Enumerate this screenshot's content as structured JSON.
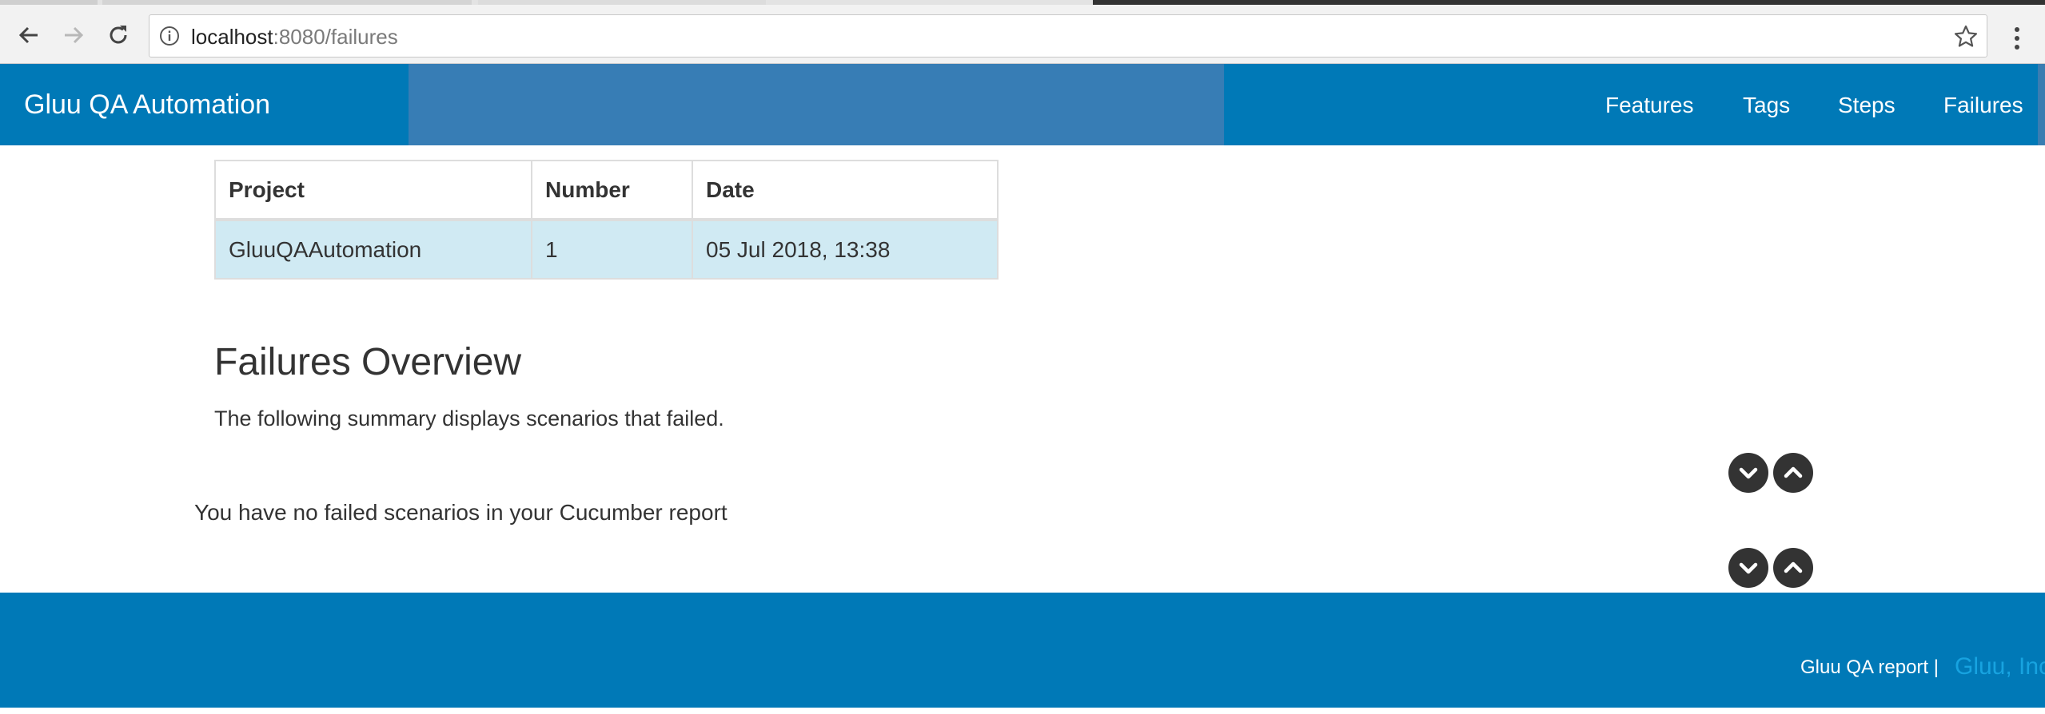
{
  "browser": {
    "url_host": "localhost",
    "url_rest": ":8080/failures"
  },
  "navbar": {
    "brand": "Gluu QA Automation",
    "items": [
      {
        "label": "Features"
      },
      {
        "label": "Tags"
      },
      {
        "label": "Steps"
      },
      {
        "label": "Failures"
      }
    ],
    "color": "#0079b7"
  },
  "report_table": {
    "headers": [
      "Project",
      "Number",
      "Date"
    ],
    "rows": [
      [
        "GluuQAAutomation",
        "1",
        "05 Jul 2018, 13:38"
      ]
    ]
  },
  "content": {
    "title": "Failures Overview",
    "description": "The following summary displays scenarios that failed.",
    "empty_message": "You have no failed scenarios in your Cucumber report"
  },
  "controls": {
    "expand_icon": "chevron-down-icon",
    "collapse_icon": "chevron-up-icon"
  },
  "footer": {
    "text": "Gluu QA report |",
    "link": "Gluu, Inc"
  },
  "colors": {
    "accent": "#0079b7",
    "row_highlight": "#d0eaf3",
    "link": "#17a3e0"
  }
}
